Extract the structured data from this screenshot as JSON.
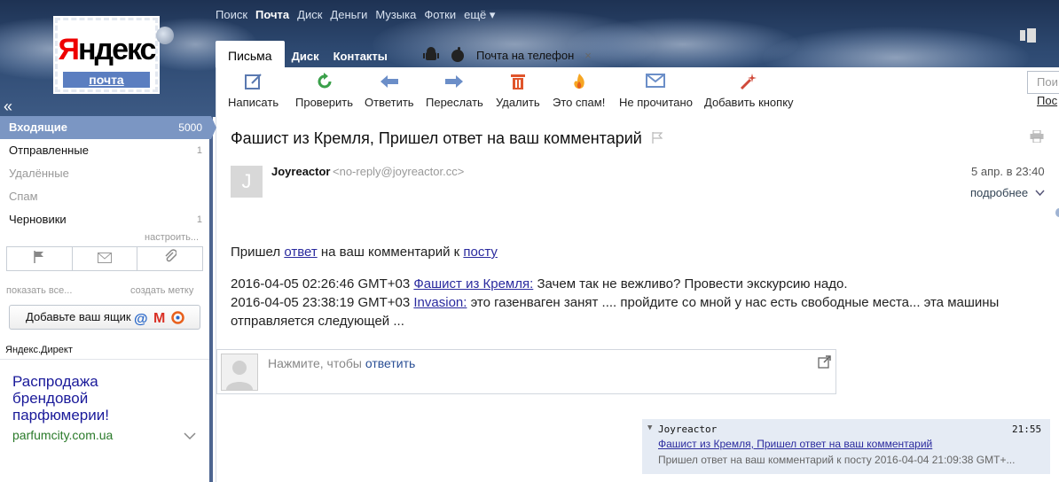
{
  "logo": {
    "text_ya": "Я",
    "text_rest": "ндекс",
    "service": "почта"
  },
  "topnav": [
    "Поиск",
    "Почта",
    "Диск",
    "Деньги",
    "Музыка",
    "Фотки",
    "ещё ▾"
  ],
  "tabs": {
    "letters": "Письма",
    "disk": "Диск",
    "contacts": "Контакты"
  },
  "phone": {
    "label": "Почта на телефон",
    "close": "×"
  },
  "toolbar": [
    {
      "label": "Написать",
      "icon": "compose-icon"
    },
    {
      "label": "Проверить",
      "icon": "refresh-icon"
    },
    {
      "label": "Ответить",
      "icon": "reply-icon"
    },
    {
      "label": "Переслать",
      "icon": "forward-icon"
    },
    {
      "label": "Удалить",
      "icon": "trash-icon"
    },
    {
      "label": "Это спам!",
      "icon": "fire-icon"
    },
    {
      "label": "Не прочитано",
      "icon": "envelope-icon"
    },
    {
      "label": "Добавить кнопку",
      "icon": "magic-wand-icon"
    }
  ],
  "search": {
    "placeholder": "Пои",
    "sub": "Пос"
  },
  "sidebar": {
    "collapse": "«",
    "folders": [
      {
        "name": "Входящие",
        "count": "5000"
      },
      {
        "name": "Отправленные",
        "count": "1"
      },
      {
        "name": "Удалённые",
        "count": ""
      },
      {
        "name": "Спам",
        "count": ""
      },
      {
        "name": "Черновики",
        "count": "1"
      }
    ],
    "setup": "настроить...",
    "show_all": "показать все...",
    "create_label": "создать метку",
    "add_box": "Добавьте ваш ящик",
    "direct": "Яндекс.Директ",
    "ad_title": "Распродажа брендовой парфюмерии!",
    "ad_url": "parfumcity.com.ua"
  },
  "message": {
    "subject": "Фашист из Кремля, Пришел ответ на ваш комментарий",
    "avatar_letter": "J",
    "sender": "Joyreactor",
    "sender_email": "<no-reply@joyreactor.cc>",
    "date": "5 апр. в 23:40",
    "more": "подробнее",
    "line1_a": "Пришел ",
    "line1_link1": "ответ",
    "line1_b": " на ваш комментарий к ",
    "line1_link2": "посту",
    "c1_time": "2016-04-05 02:26:46 GMT+03 ",
    "c1_user": "Фашист из Кремля:",
    "c1_text": " Зачем так не вежливо? Провести экскурсию надо.",
    "c2_time": "2016-04-05 23:38:19 GMT+03 ",
    "c2_user": "Invasion:",
    "c2_text": " это газенваген занят .... пройдите со мной у нас есть свободные места... эта машины отправляется следующей ..."
  },
  "reply": {
    "prefix": "Нажмите, чтобы ",
    "link": "ответить"
  },
  "thread": {
    "name": "Joyreactor",
    "time": "21:55",
    "subject": "Фашист из Кремля, Пришел ответ на ваш комментарий",
    "snippet": "Пришел ответ на ваш комментарий к посту 2016-04-04 21:09:38 GMT+..."
  }
}
